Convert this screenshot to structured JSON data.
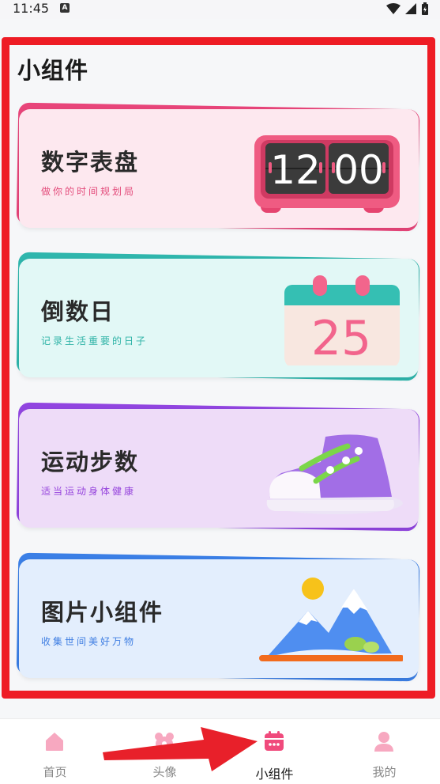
{
  "status": {
    "time": "11:45",
    "a_badge": "A"
  },
  "section_title": "小组件",
  "cards": [
    {
      "title": "数字表盘",
      "subtitle": "做你的时间规划局",
      "clock": {
        "hour": "12",
        "minute": "00"
      }
    },
    {
      "title": "倒数日",
      "subtitle": "记录生活重要的日子",
      "calendar_day": "25"
    },
    {
      "title": "运动步数",
      "subtitle": "适当运动身体健康"
    },
    {
      "title": "图片小组件",
      "subtitle": "收集世间美好万物"
    }
  ],
  "tabbar": {
    "tabs": [
      {
        "label": "首页",
        "icon": "home-icon"
      },
      {
        "label": "头像",
        "icon": "avatar-icon"
      },
      {
        "label": "小组件",
        "icon": "widget-calendar-icon",
        "active": true
      },
      {
        "label": "我的",
        "icon": "person-icon"
      }
    ]
  },
  "colors": {
    "active_tab": "#f04a7c",
    "inactive_tab_icon": "#f7a8c0",
    "annotation_frame": "#ee1c25",
    "annotation_arrow": "#e8202a"
  }
}
